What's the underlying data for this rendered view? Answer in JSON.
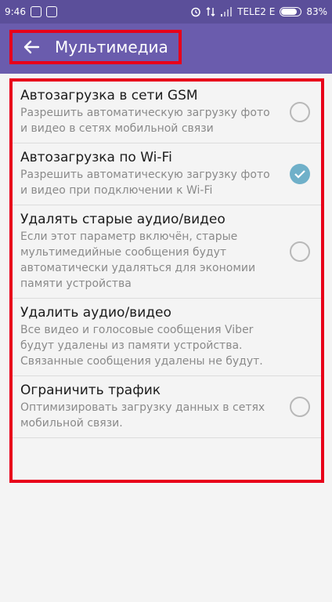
{
  "status_bar": {
    "time": "9:46",
    "carrier": "TELE2 E",
    "battery_percent": "83%",
    "battery_level": 0.83
  },
  "header": {
    "title": "Мультимедиа",
    "back_icon": "arrow-left-icon"
  },
  "colors": {
    "status_bar": "#5b4f9a",
    "app_bar": "#6a5cad",
    "highlight_frame": "#e8001a",
    "checkbox_on": "#6fb0c9",
    "checkbox_off": "#b8b8b8"
  },
  "settings": [
    {
      "title": "Автозагрузка в сети GSM",
      "description": "Разрешить автоматическую загрузку фото и видео в сетях мобильной связи",
      "checked": false
    },
    {
      "title": "Автозагрузка по Wi-Fi",
      "description": "Разрешить автоматическую загрузку фото и видео при подключении к Wi-Fi",
      "checked": true
    },
    {
      "title": "Удалять старые аудио/видео",
      "description": "Если этот параметр включён, старые мультимедийные сообщения будут автоматически удаляться для экономии памяти устройства",
      "checked": false
    },
    {
      "title": "Удалить аудио/видео",
      "description": "Все видео и голосовые сообщения Viber будут удалены из памяти устройства. Связанные сообщения удалены не будут."
    },
    {
      "title": "Ограничить трафик",
      "description": "Оптимизировать загрузку данных в сетях мобильной связи.",
      "checked": false
    }
  ]
}
